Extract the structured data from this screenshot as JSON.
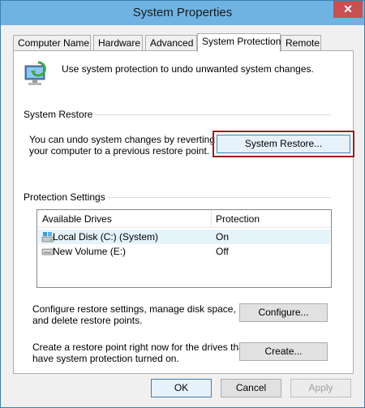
{
  "window": {
    "title": "System Properties",
    "close_label": "✕"
  },
  "tabs": [
    {
      "label": "Computer Name"
    },
    {
      "label": "Hardware"
    },
    {
      "label": "Advanced"
    },
    {
      "label": "System Protection"
    },
    {
      "label": "Remote"
    }
  ],
  "intro": "Use system protection to undo unwanted system changes.",
  "system_restore": {
    "group_label": "System Restore",
    "description_line1": "You can undo system changes by reverting",
    "description_line2": "your computer to a previous restore point.",
    "button_label": "System Restore..."
  },
  "protection": {
    "group_label": "Protection Settings",
    "columns": [
      "Available Drives",
      "Protection"
    ],
    "drives": [
      {
        "name": "Local Disk (C:) (System)",
        "protection": "On",
        "icon": "system-drive-icon"
      },
      {
        "name": "New Volume (E:)",
        "protection": "Off",
        "icon": "drive-icon"
      }
    ]
  },
  "configure": {
    "description_line1": "Configure restore settings, manage disk space,",
    "description_line2": "and delete restore points.",
    "button_label": "Configure..."
  },
  "create": {
    "description_line1": "Create a restore point right now for the drives that",
    "description_line2": "have system protection turned on.",
    "button_label": "Create..."
  },
  "footer": {
    "ok_label": "OK",
    "cancel_label": "Cancel",
    "apply_label": "Apply"
  }
}
